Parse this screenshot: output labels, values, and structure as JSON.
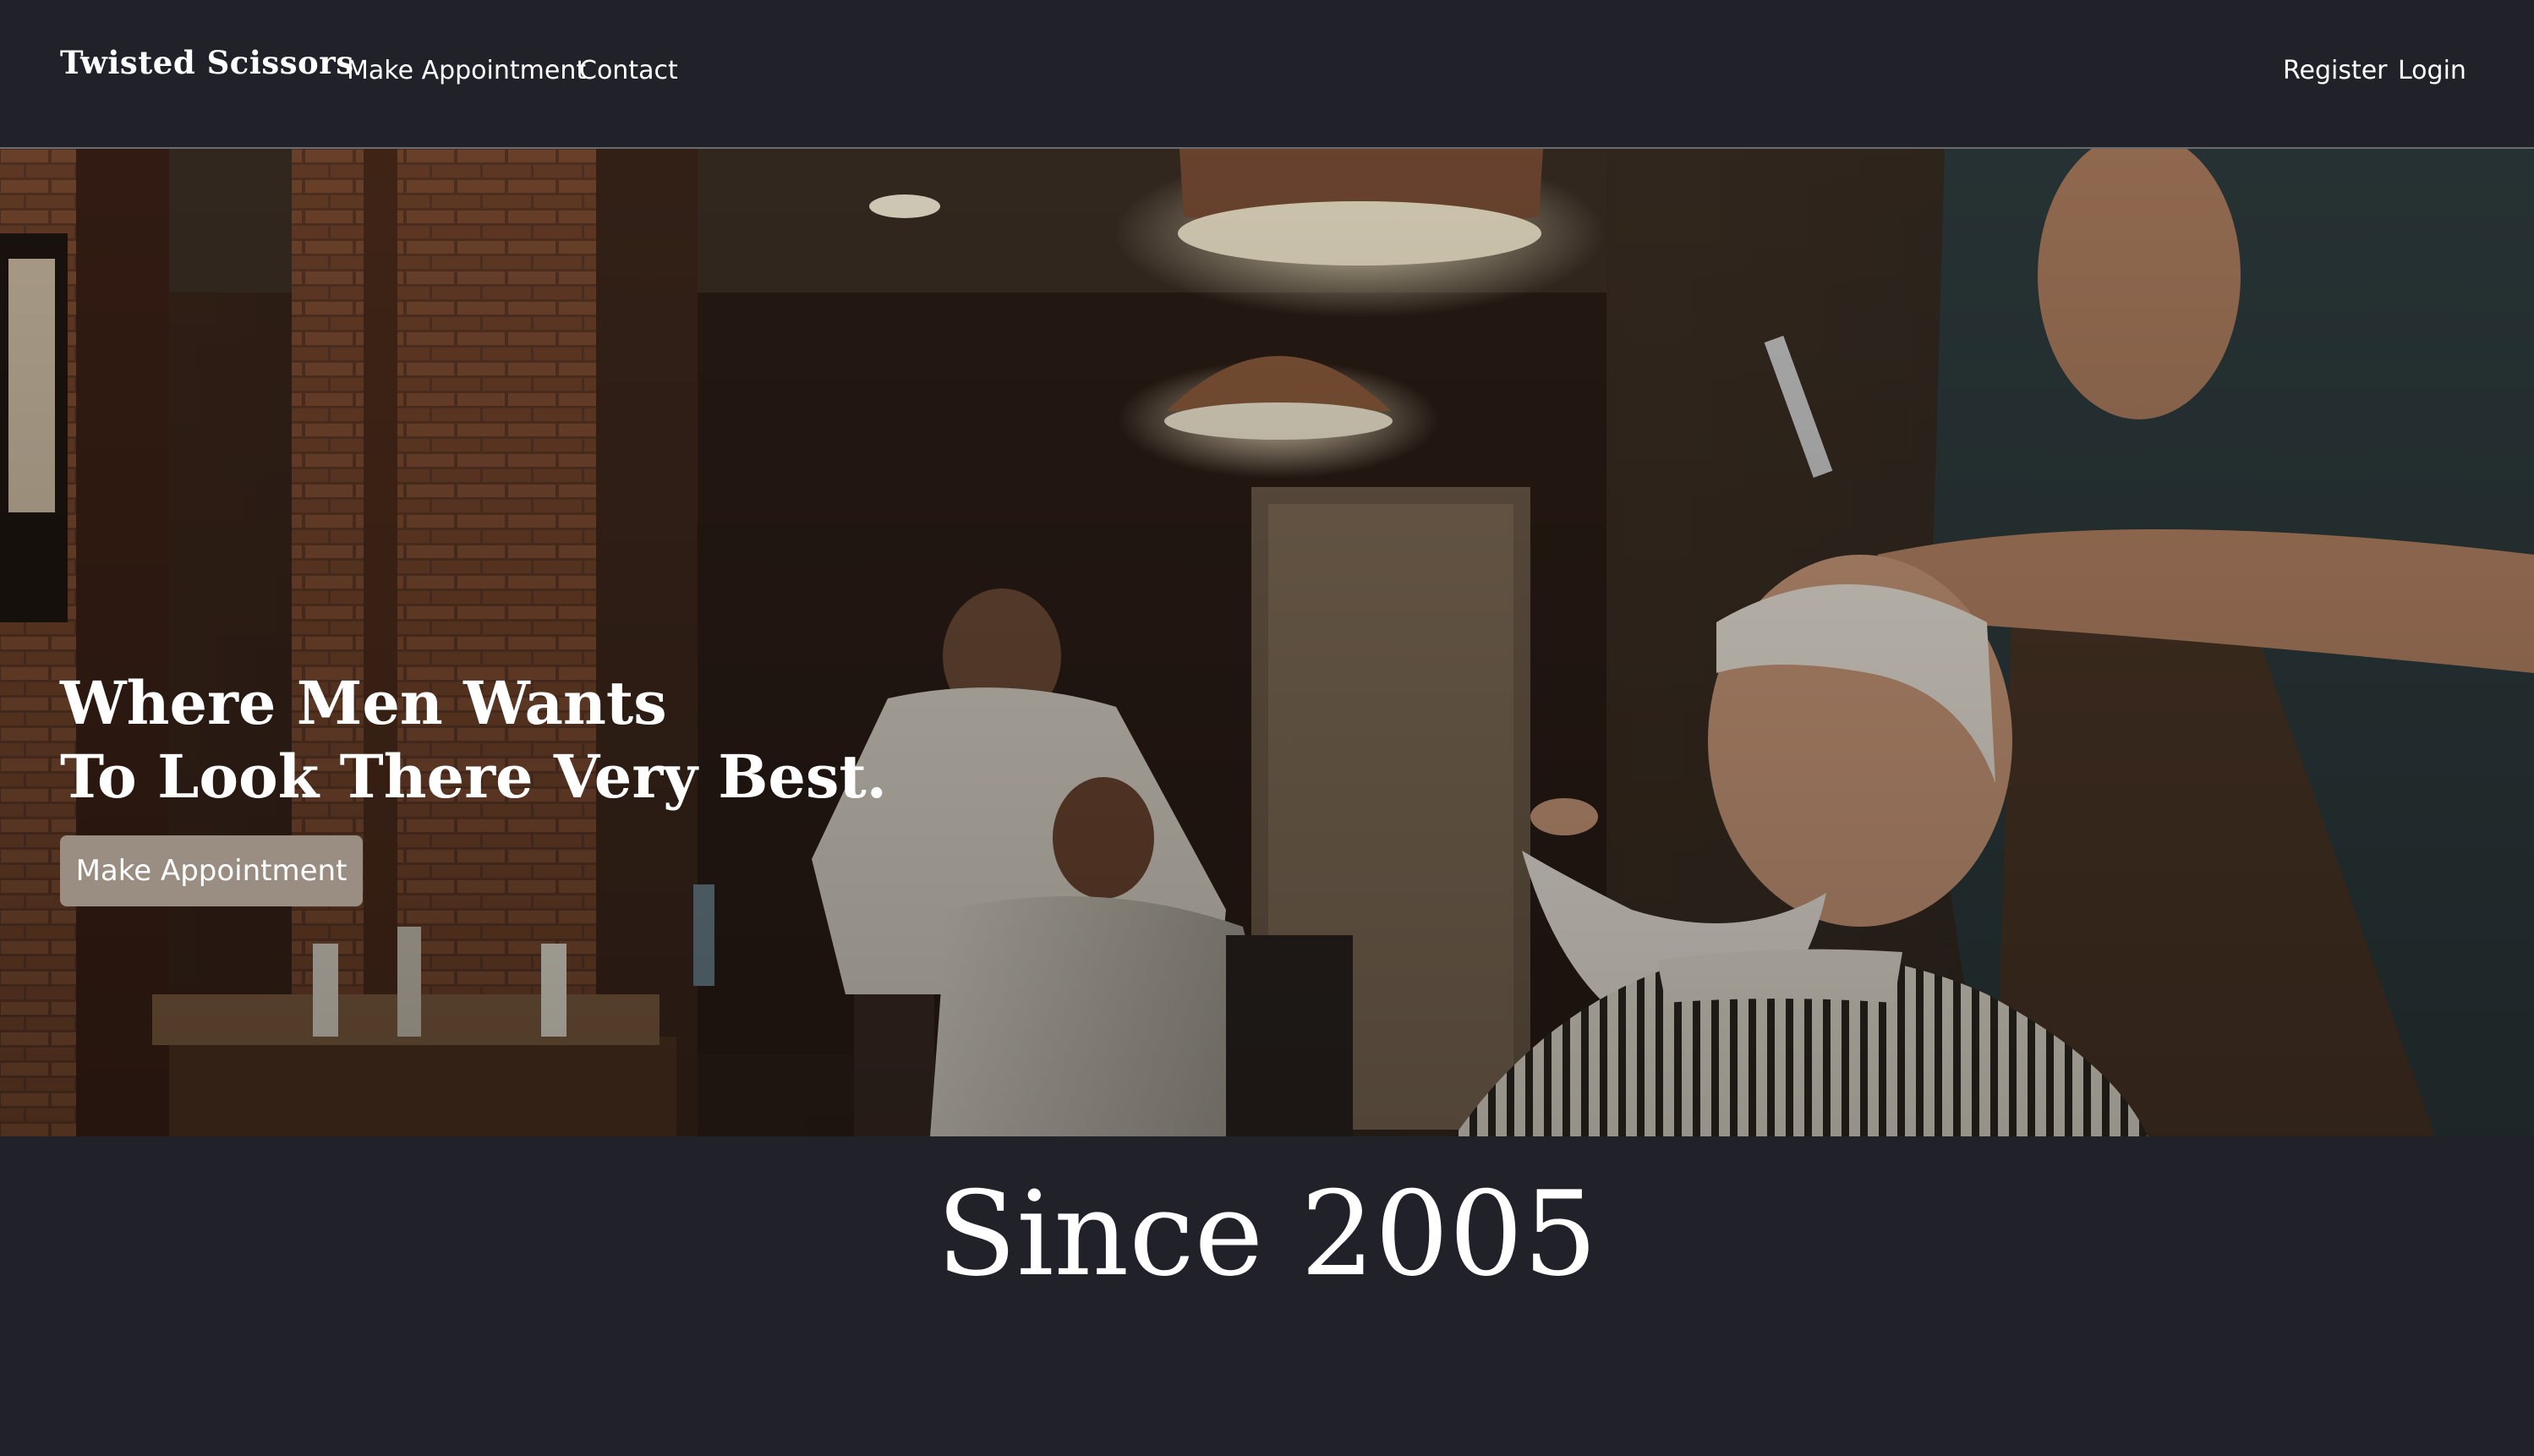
{
  "navbar": {
    "brand": "Twisted Scissors",
    "links": [
      {
        "label": "Make Appointment"
      },
      {
        "label": "Contact"
      }
    ],
    "right_links": [
      {
        "label": "Register"
      },
      {
        "label": "Login"
      }
    ]
  },
  "hero": {
    "title_line1": "Where Men Wants",
    "title_line2": "To Look There Very Best.",
    "button_label": "Make Appointment",
    "image": "barbershop-photo"
  },
  "section": {
    "heading": "Since 2005"
  },
  "colors": {
    "background": "#21212a",
    "button": "#9a8d82",
    "text": "#ffffff"
  }
}
